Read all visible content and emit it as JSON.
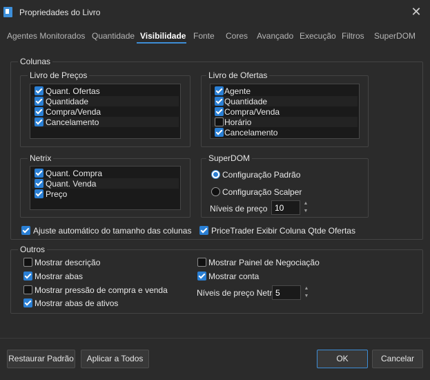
{
  "window": {
    "title": "Propriedades do Livro"
  },
  "tabs": [
    {
      "label": "Agentes Monitorados"
    },
    {
      "label": "Quantidade"
    },
    {
      "label": "Visibilidade"
    },
    {
      "label": "Fonte"
    },
    {
      "label": "Cores"
    },
    {
      "label": "Avançado"
    },
    {
      "label": "Execução"
    },
    {
      "label": "Filtros"
    },
    {
      "label": "SuperDOM"
    }
  ],
  "active_tab": "Visibilidade",
  "colunas": {
    "label": "Colunas",
    "livro_precos": {
      "label": "Livro de Preços",
      "items": [
        {
          "label": "Quant. Ofertas",
          "checked": true
        },
        {
          "label": "Quantidade",
          "checked": true
        },
        {
          "label": "Compra/Venda",
          "checked": true
        },
        {
          "label": "Cancelamento",
          "checked": true
        }
      ]
    },
    "livro_ofertas": {
      "label": "Livro de Ofertas",
      "items": [
        {
          "label": "Agente",
          "checked": true
        },
        {
          "label": "Quantidade",
          "checked": true
        },
        {
          "label": "Compra/Venda",
          "checked": true
        },
        {
          "label": "Horário",
          "checked": false
        },
        {
          "label": "Cancelamento",
          "checked": true
        }
      ]
    },
    "netrix": {
      "label": "Netrix",
      "items": [
        {
          "label": "Quant. Compra",
          "checked": true
        },
        {
          "label": "Quant. Venda",
          "checked": true
        },
        {
          "label": "Preço",
          "checked": true
        }
      ]
    },
    "superdom": {
      "label": "SuperDOM",
      "options": [
        {
          "label": "Configuração Padrão",
          "selected": true
        },
        {
          "label": "Configuração Scalper",
          "selected": false
        }
      ],
      "niveis_label": "Níveis de preço",
      "niveis_value": "10"
    },
    "ajuste_auto": {
      "label": "Ajuste automático do tamanho das colunas",
      "checked": true
    },
    "pricetrader": {
      "label": "PriceTrader Exibir Coluna Qtde Ofertas",
      "checked": true
    }
  },
  "outros": {
    "label": "Outros",
    "left": [
      {
        "label": "Mostrar descrição",
        "checked": false
      },
      {
        "label": "Mostrar abas",
        "checked": true
      },
      {
        "label": "Mostrar pressão de compra e venda",
        "checked": false
      },
      {
        "label": "Mostrar abas de ativos",
        "checked": true
      }
    ],
    "right": [
      {
        "label": "Mostrar Painel de Negociação",
        "checked": false
      },
      {
        "label": "Mostrar conta",
        "checked": true
      }
    ],
    "niveis_netrix_label": "Níveis de preço Netrix",
    "niveis_netrix_value": "5"
  },
  "footer": {
    "restaurar": "Restaurar Padrão",
    "aplicar": "Aplicar a Todos",
    "ok": "OK",
    "cancelar": "Cancelar"
  },
  "colors": {
    "accent": "#2a7fd4",
    "background": "#2b2b2b",
    "list_background": "#1a1a1a"
  }
}
